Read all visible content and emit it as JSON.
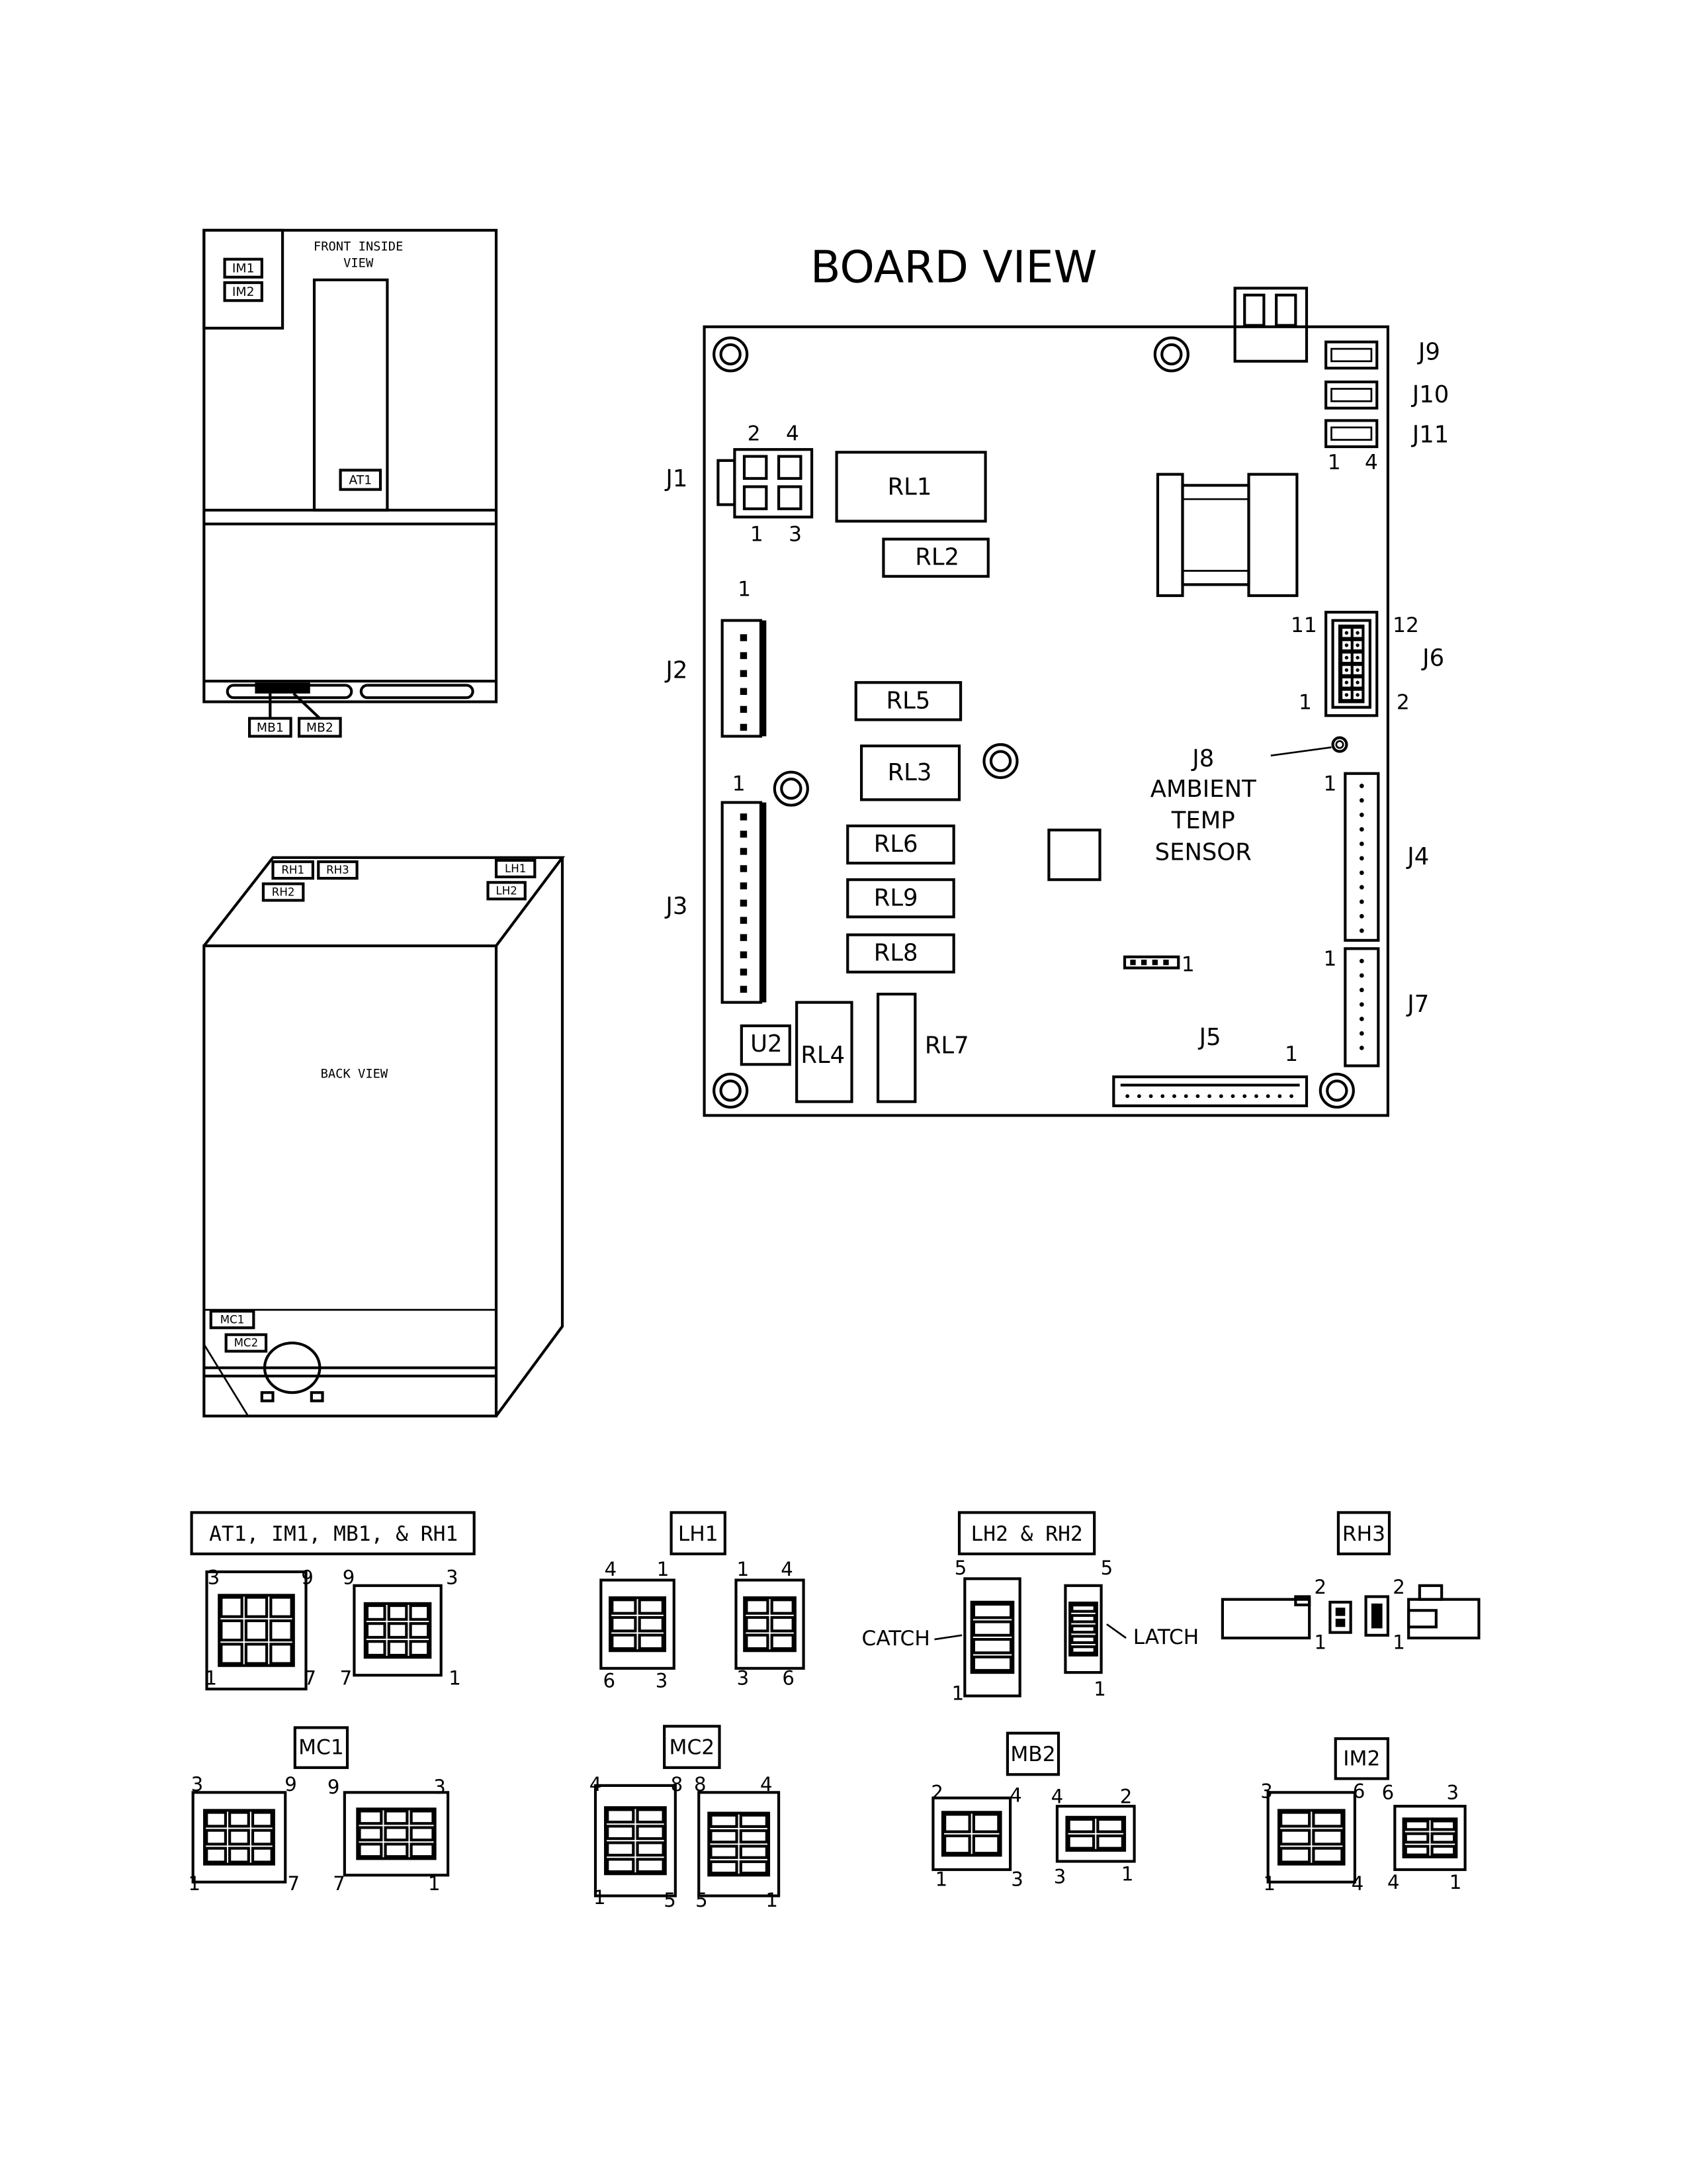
{
  "front_view": {
    "title_line1": "FRONT INSIDE",
    "title_line2": "VIEW",
    "labels": {
      "im1": "IM1",
      "im2": "IM2",
      "at1": "AT1",
      "mb1": "MB1",
      "mb2": "MB2"
    }
  },
  "back_view": {
    "title": "BACK VIEW",
    "labels": {
      "rh1": "RH1",
      "rh2": "RH2",
      "rh3": "RH3",
      "lh1": "LH1",
      "lh2": "LH2",
      "mc1": "MC1",
      "mc2": "MC2"
    }
  },
  "board_view": {
    "title": "BOARD VIEW",
    "relays": {
      "rl1": "RL1",
      "rl2": "RL2",
      "rl3": "RL3",
      "rl4": "RL4",
      "rl5": "RL5",
      "rl6": "RL6",
      "rl7": "RL7",
      "rl8": "RL8",
      "rl9": "RL9"
    },
    "u2": "U2",
    "connectors": {
      "j1": "J1",
      "j2": "J2",
      "j3": "J3",
      "j4": "J4",
      "j5": "J5",
      "j6": "J6",
      "j7": "J7",
      "j9": "J9",
      "j10": "J10",
      "j11": "J11"
    },
    "j8": {
      "name": "J8",
      "line1": "AMBIENT",
      "line2": "TEMP",
      "line3": "SENSOR"
    },
    "pins": [
      "2",
      "4",
      "1",
      "3",
      "1",
      "1",
      "1",
      "4",
      "11",
      "12",
      "1",
      "2",
      "1",
      "1",
      "1",
      "1"
    ]
  },
  "connector_legend": {
    "titles": {
      "at1_group": "AT1, IM1, MB1, & RH1",
      "lh1": "LH1",
      "lh2_rh2": "LH2 & RH2",
      "rh3": "RH3",
      "mc1": "MC1",
      "mc2": "MC2",
      "mb2": "MB2",
      "im2": "IM2"
    },
    "catch": "CATCH",
    "latch": "LATCH",
    "pins": [
      "3",
      "9",
      "1",
      "7",
      "9",
      "3",
      "7",
      "1",
      "4",
      "1",
      "6",
      "3",
      "1",
      "4",
      "3",
      "6",
      "5",
      "1",
      "5",
      "1",
      "2",
      "1",
      "2",
      "1",
      "3",
      "9",
      "1",
      "7",
      "9",
      "3",
      "7",
      "1",
      "4",
      "8",
      "1",
      "5",
      "8",
      "4",
      "5",
      "1",
      "2",
      "4",
      "1",
      "3",
      "4",
      "2",
      "3",
      "1",
      "3",
      "6",
      "1",
      "4",
      "6",
      "3",
      "4",
      "1"
    ]
  }
}
